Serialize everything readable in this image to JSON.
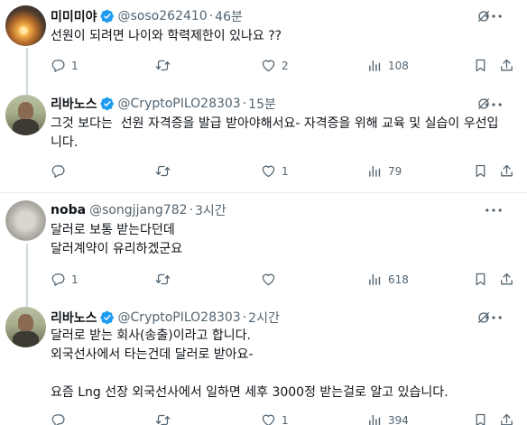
{
  "tweets": [
    {
      "name": "미미미야",
      "handle": "@soso262410",
      "sep": "·",
      "time": "46분",
      "body": "선원이 되려면 나이와 학력제한이 있나요 ??",
      "replies": "1",
      "retweets": "",
      "likes": "2",
      "views": "108"
    },
    {
      "name": "리바노스",
      "handle": "@CryptoPILO28303",
      "sep": "·",
      "time": "15분",
      "body": "그것 보다는  선원 자격증을 발급 받아야해서요- 자격증을 위해 교육 및 실습이 우선입니다.",
      "replies": "",
      "retweets": "",
      "likes": "1",
      "views": "79"
    },
    {
      "name": "noba",
      "handle": "@songjjang782",
      "sep": "·",
      "time": "3시간",
      "body": "달러로 보통 받는다던데\n달러계약이 유리하겠군요",
      "replies": "1",
      "retweets": "",
      "likes": "",
      "views": "618"
    },
    {
      "name": "리바노스",
      "handle": "@CryptoPILO28303",
      "sep": "·",
      "time": "2시간",
      "body": "달러로 받는 회사(송출)이라고 합니다.\n외국선사에서 타는건데 달러로 받아요-\n\n요즘 Lng 선장 외국선사에서 일하면 세후 3000정 받는걸로 알고 있습니다.",
      "replies": "",
      "retweets": "",
      "likes": "1",
      "views": "394"
    }
  ],
  "colors": {
    "verified": "#1d9bf0",
    "muted_text": "#536471",
    "divider": "#e6ecf0",
    "thread_line": "#cfd9de"
  },
  "icons": [
    "verified-badge-icon",
    "mute-icon",
    "more-icon",
    "reply-icon",
    "retweet-icon",
    "like-icon",
    "views-icon",
    "bookmark-icon",
    "share-icon"
  ]
}
